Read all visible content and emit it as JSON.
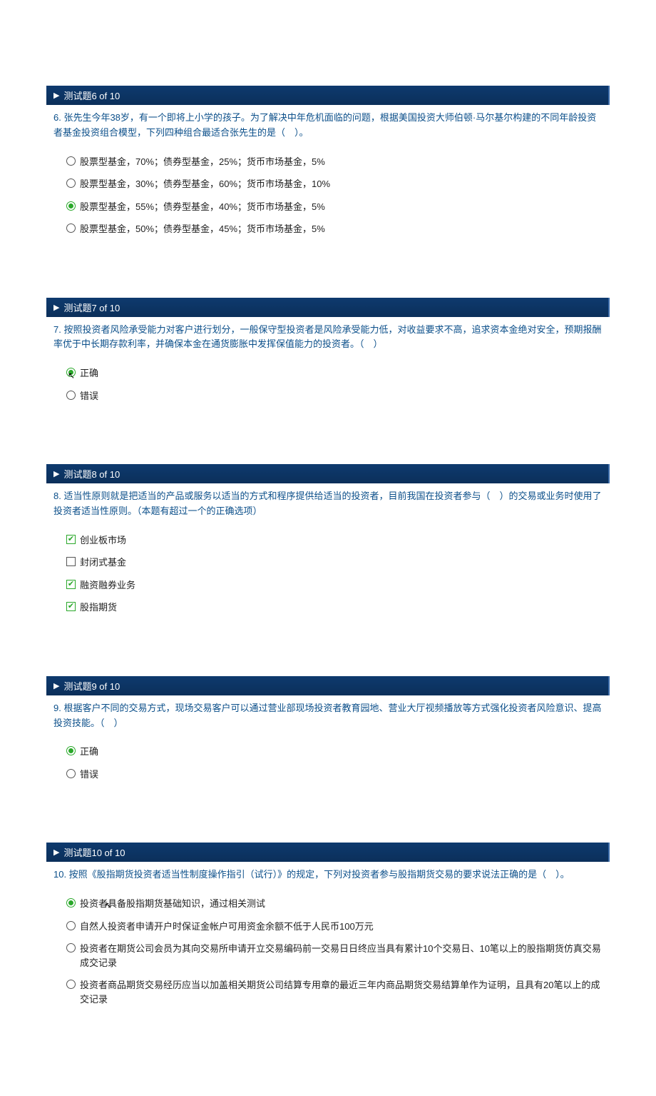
{
  "questions": [
    {
      "header": "测试题6 of 10",
      "text": "6. 张先生今年38岁，有一个即将上小学的孩子。为了解决中年危机面临的问题，根据美国投资大师伯顿·马尔基尔构建的不同年龄投资者基金投资组合模型，下列四种组合最适合张先生的是（　）。",
      "type": "radio",
      "options": [
        {
          "label": "股票型基金，70%；债券型基金，25%；货币市场基金，5%",
          "selected": false
        },
        {
          "label": "股票型基金，30%；债券型基金，60%；货币市场基金，10%",
          "selected": false
        },
        {
          "label": "股票型基金，55%；债券型基金，40%；货币市场基金，5%",
          "selected": true
        },
        {
          "label": "股票型基金，50%；债券型基金，45%；货币市场基金，5%",
          "selected": false
        }
      ]
    },
    {
      "header": "测试题7 of 10",
      "text": "7. 按照投资者风险承受能力对客户进行划分，一般保守型投资者是风险承受能力低，对收益要求不高，追求资本金绝对安全，预期报酬率优于中长期存款利率，并确保本金在通货膨胀中发挥保值能力的投资者。（　）",
      "type": "radio",
      "cursor": true,
      "options": [
        {
          "label": "正确",
          "selected": true
        },
        {
          "label": "错误",
          "selected": false
        }
      ]
    },
    {
      "header": "测试题8 of 10",
      "text": "8. 适当性原则就是把适当的产品或服务以适当的方式和程序提供给适当的投资者，目前我国在投资者参与（　）的交易或业务时使用了投资者适当性原则。（本题有超过一个的正确选项）",
      "type": "checkbox",
      "options": [
        {
          "label": "创业板市场",
          "selected": true
        },
        {
          "label": "封闭式基金",
          "selected": false
        },
        {
          "label": "融资融券业务",
          "selected": true
        },
        {
          "label": "股指期货",
          "selected": true
        }
      ]
    },
    {
      "header": "测试题9 of 10",
      "text": "9. 根据客户不同的交易方式，现场交易客户可以通过营业部现场投资者教育园地、营业大厅视频播放等方式强化投资者风险意识、提高投资技能。（　）",
      "type": "radio",
      "options": [
        {
          "label": "正确",
          "selected": true
        },
        {
          "label": "错误",
          "selected": false
        }
      ]
    },
    {
      "header": "测试题10 of 10",
      "text": "10. 按照《股指期货投资者适当性制度操作指引（试行）》的规定，下列对投资者参与股指期货交易的要求说法正确的是（　）。",
      "type": "radio",
      "cursor": true,
      "options": [
        {
          "label": "投资者具备股指期货基础知识，通过相关测试",
          "selected": true
        },
        {
          "label": "自然人投资者申请开户时保证金帐户可用资金余额不低于人民币100万元",
          "selected": false
        },
        {
          "label": "投资者在期货公司会员为其向交易所申请开立交易编码前一交易日日终应当具有累计10个交易日、10笔以上的股指期货仿真交易成交记录",
          "selected": false
        },
        {
          "label": "投资者商品期货交易经历应当以加盖相关期货公司结算专用章的最近三年内商品期货交易结算单作为证明，且具有20笔以上的成交记录",
          "selected": false
        }
      ]
    }
  ]
}
